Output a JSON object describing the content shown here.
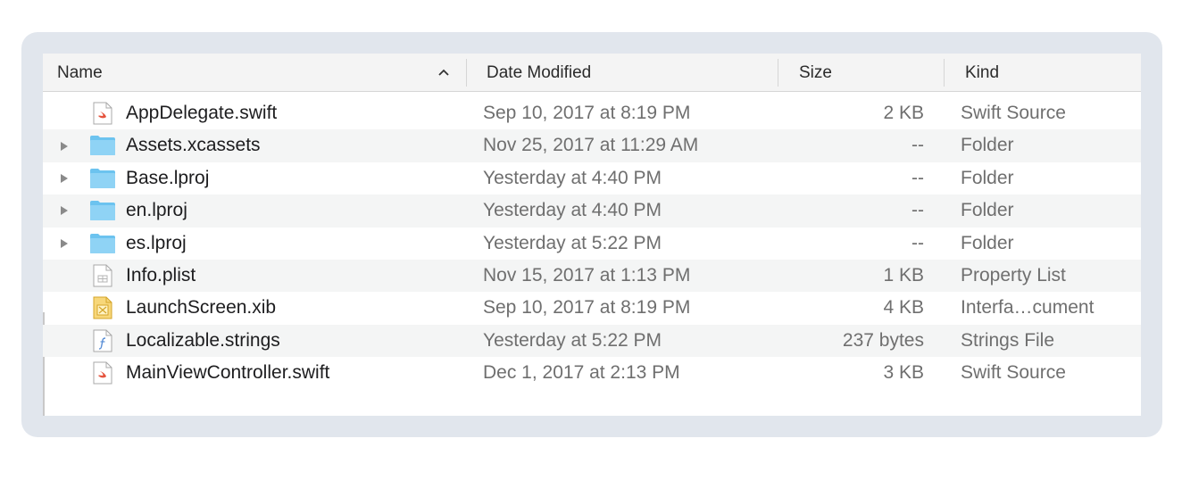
{
  "columns": {
    "name": "Name",
    "date": "Date Modified",
    "size": "Size",
    "kind": "Kind",
    "sort_indicator_icon": "chevron-up-icon"
  },
  "files": [
    {
      "name": "AppDelegate.swift",
      "date": "Sep 10, 2017 at 8:19 PM",
      "size": "2 KB",
      "kind": "Swift Source",
      "icon": "swift-file-icon",
      "expandable": false
    },
    {
      "name": "Assets.xcassets",
      "date": "Nov 25, 2017 at 11:29 AM",
      "size": "--",
      "kind": "Folder",
      "icon": "folder-icon",
      "expandable": true
    },
    {
      "name": "Base.lproj",
      "date": "Yesterday at 4:40 PM",
      "size": "--",
      "kind": "Folder",
      "icon": "folder-icon",
      "expandable": true
    },
    {
      "name": "en.lproj",
      "date": "Yesterday at 4:40 PM",
      "size": "--",
      "kind": "Folder",
      "icon": "folder-icon",
      "expandable": true
    },
    {
      "name": "es.lproj",
      "date": "Yesterday at 5:22 PM",
      "size": "--",
      "kind": "Folder",
      "icon": "folder-icon",
      "expandable": true
    },
    {
      "name": "Info.plist",
      "date": "Nov 15, 2017 at 1:13 PM",
      "size": "1 KB",
      "kind": "Property List",
      "icon": "plist-file-icon",
      "expandable": false
    },
    {
      "name": "LaunchScreen.xib",
      "date": "Sep 10, 2017 at 8:19 PM",
      "size": "4 KB",
      "kind": "Interfa…cument",
      "icon": "xib-file-icon",
      "expandable": false
    },
    {
      "name": "Localizable.strings",
      "date": "Yesterday at 5:22 PM",
      "size": "237 bytes",
      "kind": "Strings File",
      "icon": "strings-file-icon",
      "expandable": false
    },
    {
      "name": "MainViewController.swift",
      "date": "Dec 1, 2017 at 2:13 PM",
      "size": "3 KB",
      "kind": "Swift Source",
      "icon": "swift-file-icon",
      "expandable": false
    }
  ],
  "colors": {
    "folder": "#6cc3ef",
    "swift": "#e5533d",
    "xib": "#e0a526",
    "stripe": "#f4f5f5"
  }
}
